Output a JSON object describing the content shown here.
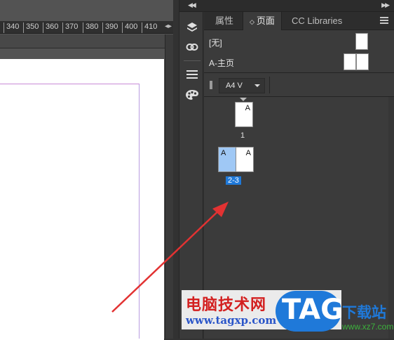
{
  "ruler": {
    "ticks": [
      "340",
      "350",
      "360",
      "370",
      "380",
      "390",
      "400",
      "410"
    ],
    "arrow": "◂▸"
  },
  "panel": {
    "tabs": [
      {
        "label": "属性"
      },
      {
        "label": "页面",
        "arrow": "◇"
      },
      {
        "label": "CC Libraries"
      }
    ],
    "masters": [
      {
        "label": "[无]"
      },
      {
        "label": "A-主页"
      }
    ],
    "page_size": {
      "value": "A4 V"
    },
    "pages": [
      {
        "number": "1",
        "letter": "A"
      },
      {
        "number": "2-3",
        "letters": [
          "A",
          "A"
        ],
        "selected": true
      }
    ]
  },
  "tool_icons": [
    "layers-icon",
    "links-icon",
    "stroke-icon",
    "swatches-icon"
  ],
  "colors": {
    "accent": "#1f79d9",
    "selection": "#9fc8f5",
    "annotation_arrow": "#e23232"
  },
  "watermark": {
    "cn": "电脑技术网",
    "url": "www.tagxp.com",
    "tag": "TAG",
    "download": "下载站",
    "site": "www.xz7.com"
  }
}
